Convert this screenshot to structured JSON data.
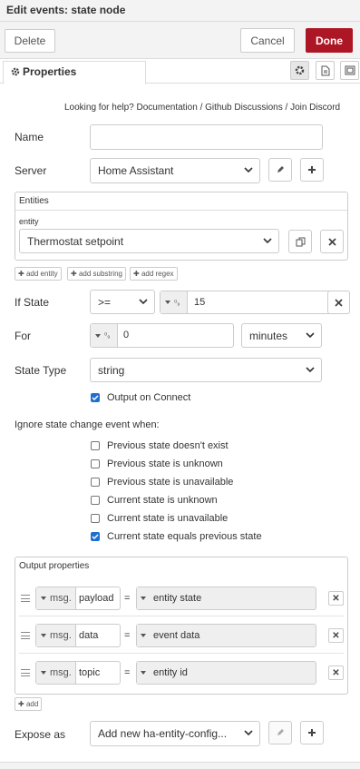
{
  "window": {
    "title": "Edit events: state node"
  },
  "toolbar": {
    "delete_label": "Delete",
    "cancel_label": "Cancel",
    "done_label": "Done"
  },
  "tabs": {
    "properties_label": "Properties"
  },
  "help": {
    "prefix": "Looking for help?",
    "documentation": "Documentation",
    "sep": "/",
    "github": "Github Discussions",
    "discord": "Join Discord"
  },
  "fields": {
    "name_label": "Name",
    "name_value": "",
    "server_label": "Server",
    "server_value": "Home Assistant",
    "entities_header": "Entities",
    "entity_label": "entity",
    "entity_value": "Thermostat setpoint",
    "add_entity": "add entity",
    "add_substring": "add substring",
    "add_regex": "add regex",
    "if_state_label": "If State",
    "if_state_op": ">=",
    "if_state_type": "0/9",
    "if_state_value": "15",
    "for_label": "For",
    "for_type": "0/9",
    "for_value": "0",
    "for_unit": "minutes",
    "state_type_label": "State Type",
    "state_type_value": "string",
    "output_on_connect": "Output on Connect"
  },
  "ignore": {
    "heading": "Ignore state change event when:",
    "options": [
      {
        "label": "Previous state doesn't exist",
        "checked": false
      },
      {
        "label": "Previous state is unknown",
        "checked": false
      },
      {
        "label": "Previous state is unavailable",
        "checked": false
      },
      {
        "label": "Current state is unknown",
        "checked": false
      },
      {
        "label": "Current state is unavailable",
        "checked": false
      },
      {
        "label": "Current state equals previous state",
        "checked": true
      }
    ]
  },
  "output": {
    "header": "Output properties",
    "rows": [
      {
        "prefix": "msg.",
        "property": "payload",
        "eq": "=",
        "value": "entity state"
      },
      {
        "prefix": "msg.",
        "property": "data",
        "eq": "=",
        "value": "event data"
      },
      {
        "prefix": "msg.",
        "property": "topic",
        "eq": "=",
        "value": "entity id"
      }
    ],
    "add_label": "add"
  },
  "expose": {
    "label": "Expose as",
    "value": "Add new ha-entity-config..."
  },
  "colors": {
    "accent": "#ad1625",
    "checkbox": "#1f6fd1"
  }
}
